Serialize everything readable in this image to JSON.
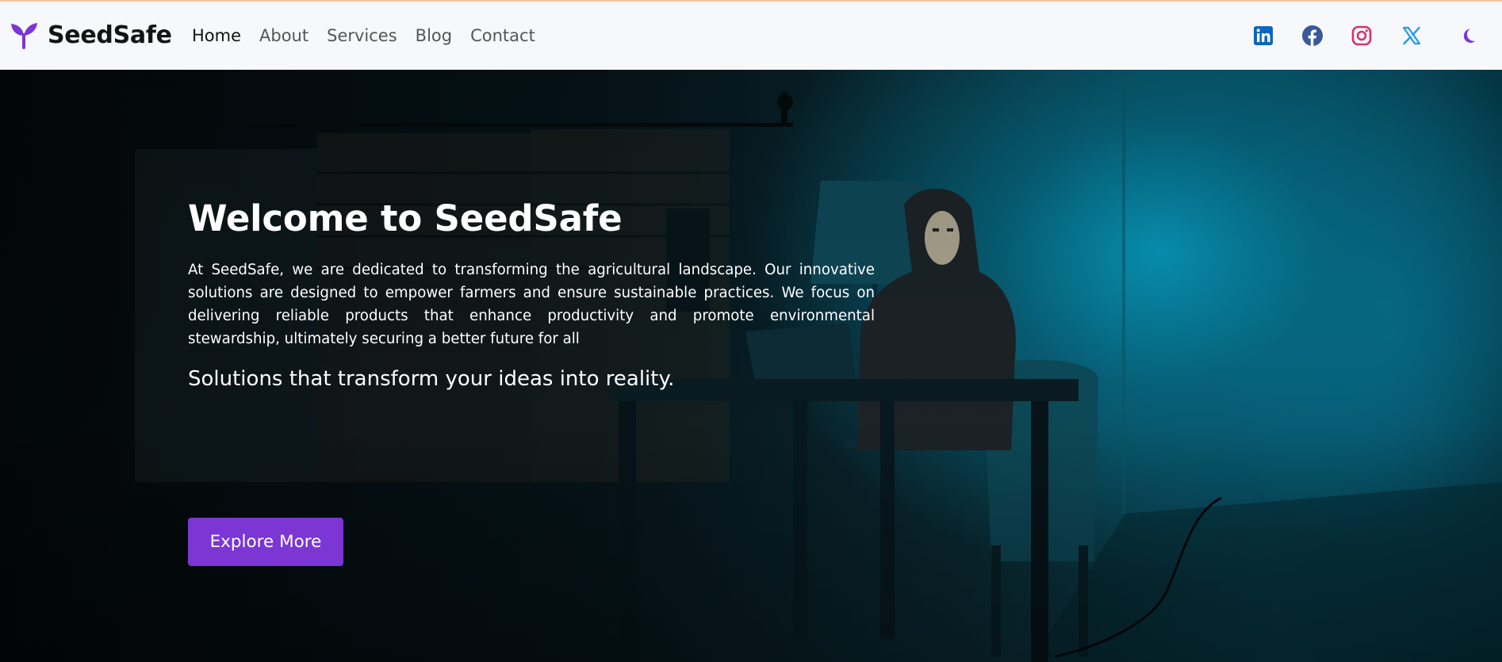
{
  "brand": {
    "name": "SeedSafe",
    "logo_icon": "sprout-icon",
    "logo_color": "#7b36d4"
  },
  "nav": {
    "items": [
      {
        "label": "Home",
        "active": true
      },
      {
        "label": "About",
        "active": false
      },
      {
        "label": "Services",
        "active": false
      },
      {
        "label": "Blog",
        "active": false
      },
      {
        "label": "Contact",
        "active": false
      }
    ]
  },
  "social": [
    {
      "icon": "linkedin-icon",
      "color": "#0a66c2"
    },
    {
      "icon": "facebook-icon",
      "color": "#3b5998"
    },
    {
      "icon": "instagram-icon",
      "color": "#d6336c"
    },
    {
      "icon": "x-twitter-icon",
      "color": "#1d9bf0"
    },
    {
      "icon": "moon-icon",
      "color": "#7b36d4"
    }
  ],
  "hero": {
    "title": "Welcome to SeedSafe",
    "text": "At SeedSafe, we are dedicated to transforming the agricultural landscape. Our innovative solutions are designed to empower farmers and ensure sustainable practices. We focus on delivering reliable products that enhance productivity and promote environmental stewardship, ultimately securing a better future for all",
    "tagline": "Solutions that transform your ideas into reality.",
    "button_label": "Explore More",
    "button_color": "#7b36d4"
  }
}
